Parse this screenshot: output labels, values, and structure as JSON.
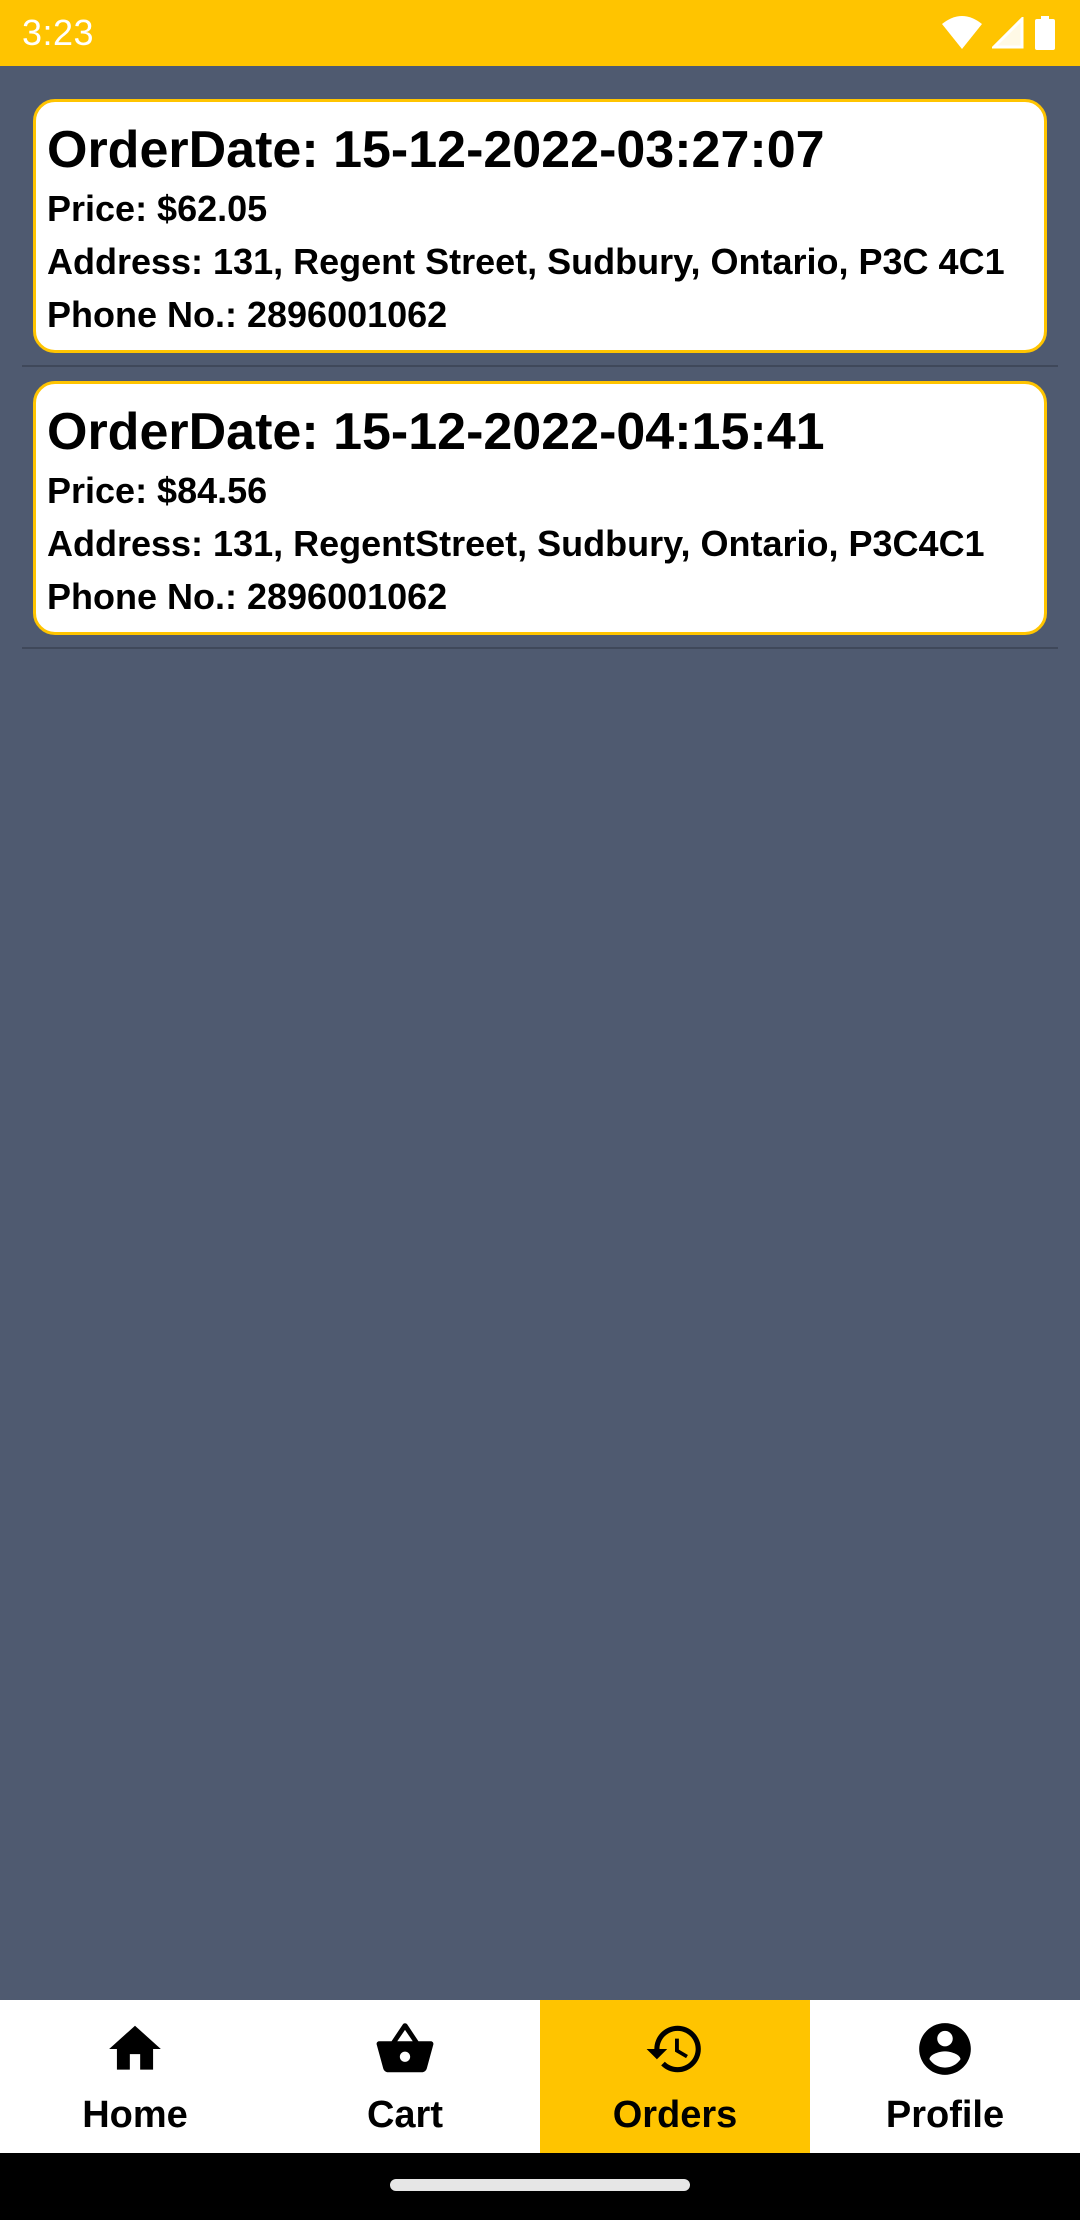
{
  "status_bar": {
    "time": "3:23",
    "icons": [
      "wifi-icon",
      "cellular-signal-icon",
      "battery-icon"
    ]
  },
  "orders": [
    {
      "order_date": "OrderDate: 15-12-2022-03:27:07",
      "price": "Price: $62.05",
      "address": "Address: 131, Regent Street, Sudbury, Ontario, P3C 4C1",
      "phone": "Phone No.: 2896001062"
    },
    {
      "order_date": "OrderDate: 15-12-2022-04:15:41",
      "price": "Price: $84.56",
      "address": "Address: 131, RegentStreet, Sudbury, Ontario, P3C4C1",
      "phone": "Phone No.: 2896001062"
    }
  ],
  "bottom_nav": {
    "items": [
      {
        "label": "Home",
        "icon": "home-icon",
        "active": false
      },
      {
        "label": "Cart",
        "icon": "basket-icon",
        "active": false
      },
      {
        "label": "Orders",
        "icon": "history-icon",
        "active": true
      },
      {
        "label": "Profile",
        "icon": "account-circle-icon",
        "active": false
      }
    ]
  },
  "colors": {
    "accent": "#ffc400",
    "background": "#4f5a70",
    "card": "#ffffff",
    "text": "#000000"
  }
}
